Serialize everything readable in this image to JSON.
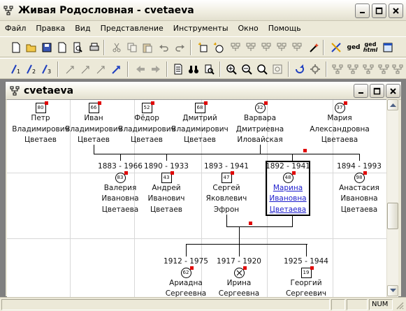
{
  "app": {
    "title": "Живая Родословная - cvetaeva",
    "icon": "family-tree-icon"
  },
  "menu": [
    "Файл",
    "Правка",
    "Вид",
    "Представление",
    "Инструменты",
    "Окно",
    "Помощь"
  ],
  "toolbar1": {
    "buttons": [
      "new-doc-icon",
      "open-folder-icon",
      "save-icon",
      "page-icon",
      "print-preview-icon",
      "print-icon",
      "cut-icon",
      "copy-icon",
      "paste-icon",
      "undo-icon",
      "redo-icon",
      "new-person-icon",
      "new-relation-icon",
      "tree-tool-icon",
      "tree-tool-icon",
      "tree-tool-icon",
      "tree-tool-icon",
      "tree-tool-icon",
      "wand-icon",
      "gedcom-import-icon",
      "gedcom-export-icon",
      "gedcom-html-icon",
      "web-export-icon"
    ],
    "ged_label": "ged",
    "gedhtml_label1": "ged",
    "gedhtml_label2": "html"
  },
  "toolbar2": {
    "buttons": [
      "gen1-icon",
      "gen2-icon",
      "gen3-icon",
      "nav-icon",
      "nav-icon",
      "nav-icon",
      "nav-icon",
      "back-arrow-icon",
      "forward-arrow-icon",
      "document-icon",
      "binoculars-icon",
      "find-icon",
      "zoom-in-icon",
      "zoom-out-icon",
      "zoom-fit-icon",
      "zoom-page-icon",
      "refresh-icon",
      "settings-icon",
      "layout-icon",
      "layout-icon",
      "layout-icon",
      "layout-icon",
      "layout-icon",
      "layout-icon"
    ]
  },
  "child_window": {
    "title": "cvetaeva"
  },
  "tree": {
    "generation1": [
      {
        "id": "80",
        "first": "Петр",
        "middle": "Владимирович",
        "last": "Цветаев",
        "shape": "square"
      },
      {
        "id": "66",
        "first": "Иван",
        "middle": "Владимирович",
        "last": "Цветаев",
        "shape": "square"
      },
      {
        "id": "52",
        "first": "Фёдор",
        "middle": "Владимирович",
        "last": "Цветаев",
        "shape": "square"
      },
      {
        "id": "68",
        "first": "Дмитрий",
        "middle": "Владимирович",
        "last": "Цветаев",
        "shape": "square"
      },
      {
        "id": "32",
        "first": "Варвара",
        "middle": "Дмитриевна",
        "last": "Иловайская",
        "shape": "circle"
      },
      {
        "id": "37",
        "first": "Мария",
        "middle": "Александровна",
        "last": "Цветаева",
        "shape": "circle"
      }
    ],
    "generation2": [
      {
        "id": "83",
        "dates": "1883 - 1966",
        "first": "Валерия",
        "middle": "Ивановна",
        "last": "Цветаева",
        "shape": "circle"
      },
      {
        "id": "43",
        "dates": "1890 - 1933",
        "first": "Андрей",
        "middle": "Иванович",
        "last": "Цветаев",
        "shape": "square"
      },
      {
        "id": "47",
        "dates": "1893 - 1941",
        "first": "Сергей",
        "middle": "Яковлевич",
        "last": "Эфрон",
        "shape": "square"
      },
      {
        "id": "48",
        "dates": "1892 - 1941",
        "first": "Марина",
        "middle": "Ивановна",
        "last": "Цветаева",
        "shape": "circle",
        "selected": true
      },
      {
        "id": "98",
        "dates": "1894 - 1993",
        "first": "Анастасия",
        "middle": "Ивановна",
        "last": "Цветаева",
        "shape": "circle"
      }
    ],
    "generation3": [
      {
        "id": "62",
        "dates": "1912 - 1975",
        "first": "Ариадна",
        "middle": "Сергеевна",
        "shape": "circle"
      },
      {
        "id": "",
        "dates": "1917 - 1920",
        "first": "Ирина",
        "middle": "Сергеевна",
        "shape": "circle-x"
      },
      {
        "id": "19",
        "dates": "1925 - 1944",
        "first": "Георгий",
        "middle": "Сергеевич",
        "shape": "square"
      }
    ]
  },
  "status": {
    "num": "NUM"
  }
}
